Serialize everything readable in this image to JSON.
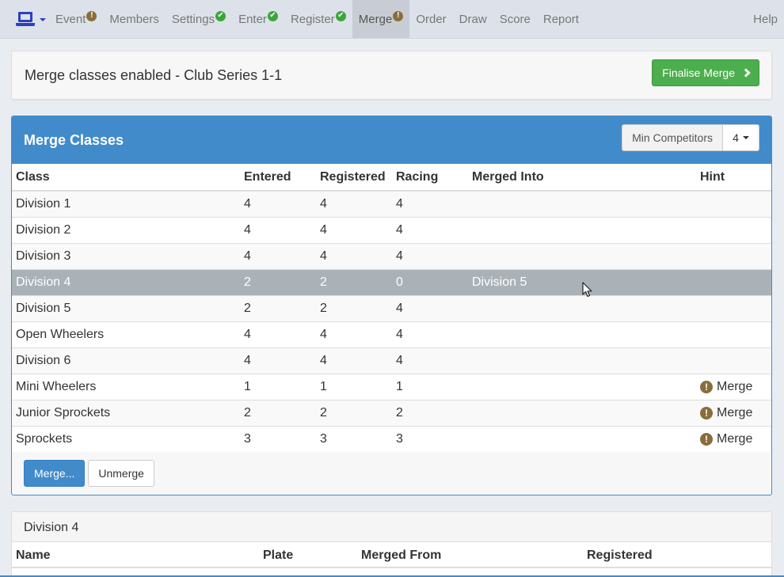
{
  "nav": {
    "items": [
      {
        "label": "Event",
        "badge": "warn"
      },
      {
        "label": "Members",
        "badge": ""
      },
      {
        "label": "Settings",
        "badge": "ok"
      },
      {
        "label": "Enter",
        "badge": "ok"
      },
      {
        "label": "Register",
        "badge": "ok"
      },
      {
        "label": "Merge",
        "badge": "warn",
        "active": true
      },
      {
        "label": "Order",
        "badge": ""
      },
      {
        "label": "Draw",
        "badge": ""
      },
      {
        "label": "Score",
        "badge": ""
      },
      {
        "label": "Report",
        "badge": ""
      }
    ],
    "help": "Help"
  },
  "top": {
    "title": "Merge classes enabled - Club Series 1-1",
    "finalise_label": "Finalise Merge"
  },
  "merge": {
    "title": "Merge Classes",
    "min_label": "Min Competitors",
    "min_value": "4",
    "columns": [
      "Class",
      "Entered",
      "Registered",
      "Racing",
      "Merged Into",
      "Hint"
    ],
    "rows": [
      {
        "class": "Division 1",
        "entered": "4",
        "registered": "4",
        "racing": "4",
        "merged_into": "",
        "hint": ""
      },
      {
        "class": "Division 2",
        "entered": "4",
        "registered": "4",
        "racing": "4",
        "merged_into": "",
        "hint": ""
      },
      {
        "class": "Division 3",
        "entered": "4",
        "registered": "4",
        "racing": "4",
        "merged_into": "",
        "hint": ""
      },
      {
        "class": "Division 4",
        "entered": "2",
        "registered": "2",
        "racing": "0",
        "merged_into": "Division 5",
        "hint": "",
        "selected": true
      },
      {
        "class": "Division 5",
        "entered": "2",
        "registered": "2",
        "racing": "4",
        "merged_into": "",
        "hint": ""
      },
      {
        "class": "Open Wheelers",
        "entered": "4",
        "registered": "4",
        "racing": "4",
        "merged_into": "",
        "hint": ""
      },
      {
        "class": "Division 6",
        "entered": "4",
        "registered": "4",
        "racing": "4",
        "merged_into": "",
        "hint": ""
      },
      {
        "class": "Mini Wheelers",
        "entered": "1",
        "registered": "1",
        "racing": "1",
        "merged_into": "",
        "hint": "Merge"
      },
      {
        "class": "Junior Sprockets",
        "entered": "2",
        "registered": "2",
        "racing": "2",
        "merged_into": "",
        "hint": "Merge"
      },
      {
        "class": "Sprockets",
        "entered": "3",
        "registered": "3",
        "racing": "3",
        "merged_into": "",
        "hint": "Merge"
      }
    ],
    "merge_button": "Merge...",
    "unmerge_button": "Unmerge"
  },
  "detail": {
    "title": "Division 4",
    "columns": [
      "Name",
      "Plate",
      "Merged From",
      "Registered"
    ]
  },
  "colors": {
    "primary": "#428bca",
    "success": "#4cae4c",
    "warning": "#8a6d3b",
    "selected_row": "#aab2b8",
    "brand_icon": "#2d3fc1"
  },
  "icons": {
    "brand": "laptop-icon",
    "ok": "check-circle-icon",
    "warn": "exclamation-circle-icon",
    "finalise": "chevron-right-icon"
  }
}
